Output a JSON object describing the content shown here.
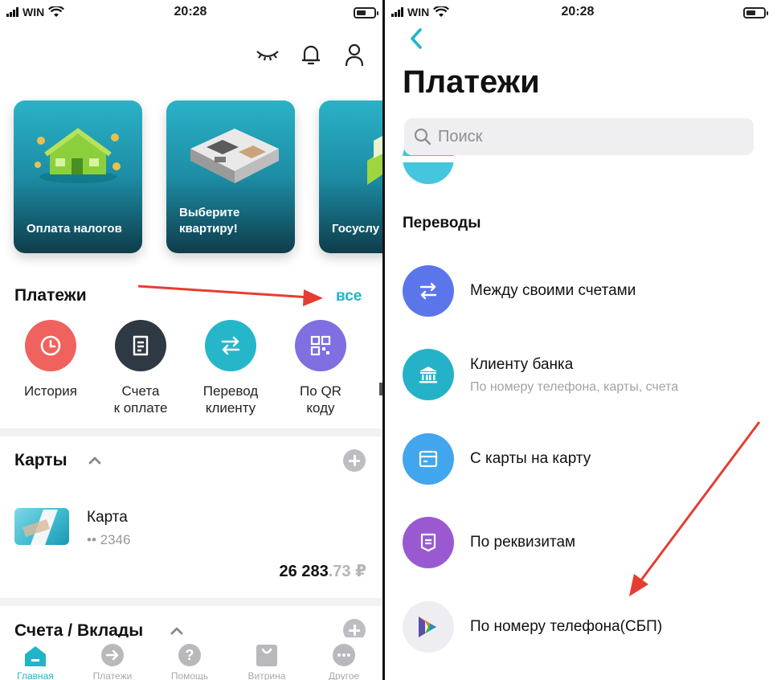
{
  "left": {
    "status": {
      "carrier": "WIN",
      "time": "20:28"
    },
    "promos": [
      {
        "label": "Оплата налогов"
      },
      {
        "label": "Выберите квартиру!"
      },
      {
        "label": "Госуслу"
      }
    ],
    "payments": {
      "title": "Платежи",
      "all_link": "все",
      "actions": [
        {
          "line1": "История",
          "line2": "",
          "color": "#f0625d"
        },
        {
          "line1": "Счета",
          "line2": "к оплате",
          "color": "#2f3943"
        },
        {
          "line1": "Перевод",
          "line2": "клиенту",
          "color": "#26b6c9"
        },
        {
          "line1": "По QR",
          "line2": "коду",
          "color": "#7f6fe0"
        }
      ]
    },
    "cards": {
      "title": "Карты",
      "card_name": "Карта",
      "card_number": "•• 2346",
      "balance_main": "26 283",
      "balance_cents": ".73 ₽"
    },
    "accounts": {
      "title": "Счета / Вклады"
    },
    "tabbar": [
      {
        "label": "Главная",
        "active": true
      },
      {
        "label": "Платежи",
        "active": false
      },
      {
        "label": "Помощь",
        "active": false
      },
      {
        "label": "Витрина",
        "active": false
      },
      {
        "label": "Другое",
        "active": false
      }
    ],
    "accent_color": "#1fb5c9"
  },
  "right": {
    "status": {
      "carrier": "WIN",
      "time": "20:28"
    },
    "title": "Платежи",
    "search": {
      "placeholder": "Поиск"
    },
    "group_title": "Переводы",
    "transfers": [
      {
        "title": "Между своими счетами",
        "subtitle": "",
        "color": "#5b76ea",
        "icon": "arrows-swap-icon"
      },
      {
        "title": "Клиенту банка",
        "subtitle": "По номеру телефона, карты, счета",
        "color": "#25b2c8",
        "icon": "bank-icon"
      },
      {
        "title": "С карты на карту",
        "subtitle": "",
        "color": "#41a6ee",
        "icon": "card-icon"
      },
      {
        "title": "По реквизитам",
        "subtitle": "",
        "color": "#9a59d1",
        "icon": "document-icon"
      },
      {
        "title": "По номеру телефона(СБП)",
        "subtitle": "",
        "color": "#eeeef2",
        "icon": "sbp-logo-icon"
      }
    ]
  }
}
